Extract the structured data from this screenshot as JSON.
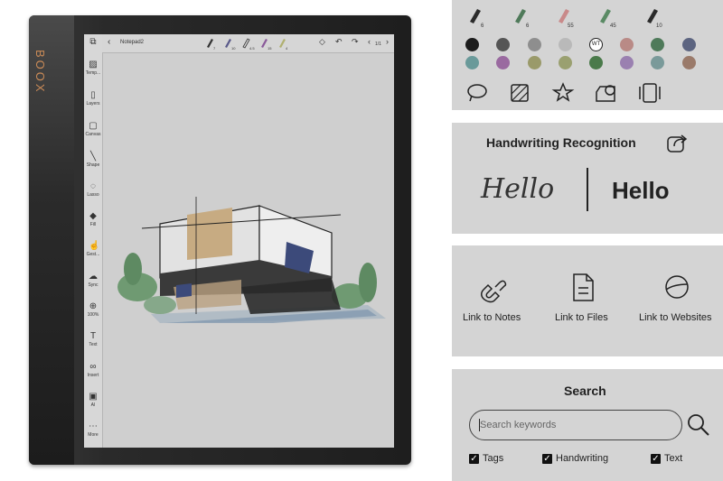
{
  "device": {
    "brand": "BOOX",
    "notebook_title": "Notepad2",
    "page_indicator": "1/1",
    "tools": [
      "Temp...",
      "Layers",
      "Canvas",
      "Shape",
      "Lasso",
      "Fill",
      "Gest...",
      "Sync",
      "100%",
      "Text",
      "Insert",
      "AI",
      "More"
    ],
    "pen_sizes": [
      "7",
      "10",
      "4.5",
      "15",
      "4"
    ]
  },
  "pens_panel": {
    "pen_sizes": [
      "6",
      "6",
      "55",
      "45",
      "10"
    ],
    "pen_colors": [
      "#2b2b2b",
      "#4f7a5a",
      "#c98a8a",
      "#5a8a64",
      "#2b2b2b"
    ],
    "color_row1": [
      "#1c1c1c",
      "#555555",
      "#8e8e8e",
      "#b9b9b9",
      "WT",
      "#b98a86",
      "#4f7a5a",
      "#5c6480"
    ],
    "color_row2": [
      "#6a9a9a",
      "#9a6aa0",
      "#9a9a6a",
      "#9aa070",
      "#4a7a4a",
      "#9a80b0",
      "#7a9a9a",
      "#9a7a6a"
    ],
    "tool_icons": [
      "lasso-icon",
      "fill-pattern-icon",
      "star-icon",
      "shape-icon",
      "layers-icon"
    ]
  },
  "handwriting": {
    "title": "Handwriting Recognition",
    "input_text": "Hello",
    "output_text": "Hello"
  },
  "links": {
    "items": [
      "Link to Notes",
      "Link to Files",
      "Link to Websites"
    ]
  },
  "search": {
    "title": "Search",
    "placeholder": "Search keywords",
    "filters": [
      "Tags",
      "Handwriting",
      "Text"
    ]
  }
}
